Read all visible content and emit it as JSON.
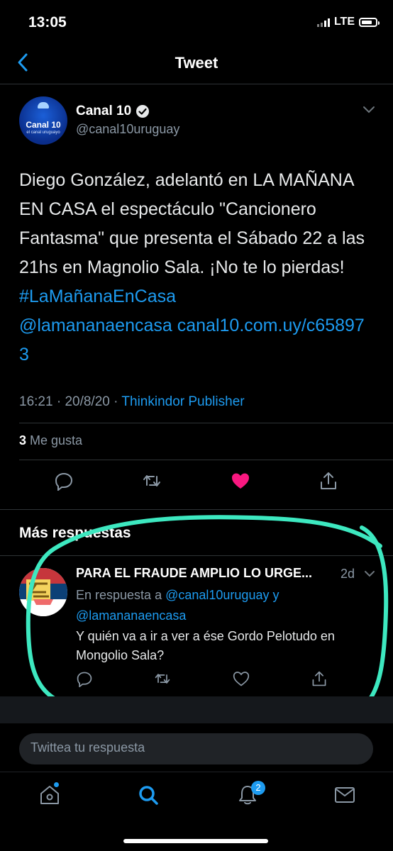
{
  "status_bar": {
    "time": "13:05",
    "network": "LTE"
  },
  "header": {
    "title": "Tweet"
  },
  "tweet": {
    "author_name": "Canal 10",
    "avatar_line1": "Canal 10",
    "avatar_line2": "el canal uruguayo",
    "handle": "@canal10uruguay",
    "text_plain": "Diego González, adelantó en LA MAÑANA EN CASA el espectáculo \"Cancionero Fantasma\" que presenta el Sábado 22 a las 21hs en Magnolio Sala. ¡No te lo pierdas! ",
    "hashtag": "#LaMañanaEnCasa",
    "mention": "@lamananaencasa",
    "link": "canal10.com.uy/c658973",
    "time": "16:21",
    "date": "20/8/20",
    "source": "Thinkindor Publisher",
    "likes_count": "3",
    "likes_label": "Me gusta"
  },
  "more_replies": {
    "heading": "Más respuestas",
    "reply": {
      "author_name": "PARA EL FRAUDE AMPLIO LO URGE...",
      "time": "2d",
      "reply_prefix": "En respuesta a",
      "reply_to_1": "@canal10uruguay",
      "reply_and": "y",
      "reply_to_2": "@lamananaencasa",
      "text": "Y quién va a ir a ver a ése Gordo Pelotudo en Mongolio Sala?"
    }
  },
  "composer": {
    "placeholder": "Twittea tu respuesta"
  },
  "tab_bar": {
    "notifications_badge": "2"
  },
  "colors": {
    "accent": "#1d9bf0",
    "like": "#f91880",
    "highlight": "#3de8c0",
    "background": "#000000"
  },
  "icons": [
    "back-icon",
    "verified-icon",
    "chevron-down-icon",
    "reply-icon",
    "retweet-icon",
    "like-icon",
    "share-icon",
    "home-icon",
    "search-icon",
    "bell-icon",
    "mail-icon"
  ]
}
